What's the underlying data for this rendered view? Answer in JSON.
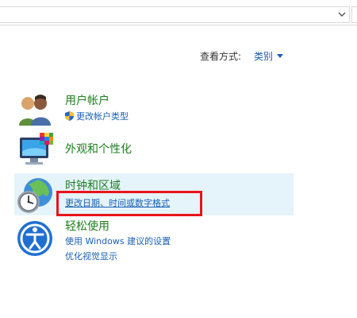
{
  "view_by": {
    "label": "查看方式:",
    "value": "类别"
  },
  "categories": [
    {
      "title": "用户帐户",
      "links": [
        "更改帐户类型"
      ]
    },
    {
      "title": "外观和个性化",
      "links": []
    },
    {
      "title": "时钟和区域",
      "links": [
        "更改日期、时间或数字格式"
      ]
    },
    {
      "title": "轻松使用",
      "links": [
        "使用 Windows 建议的设置",
        "优化视觉显示"
      ]
    }
  ],
  "colors": {
    "title_green": "#1e7e1e",
    "link_blue": "#1a5fb4",
    "selected_bg": "#e5f3fb",
    "highlight_red": "#e8141a"
  },
  "icons": {
    "user_accounts": "users-icon",
    "appearance": "monitor-palette-icon",
    "clock_region": "clock-globe-icon",
    "ease_of_access": "ease-of-access-icon",
    "uac": "uac-shield-icon"
  }
}
